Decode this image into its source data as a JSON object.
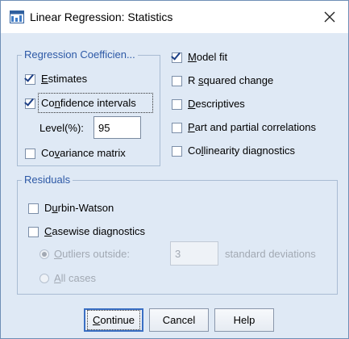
{
  "window": {
    "title": "Linear Regression: Statistics"
  },
  "regression_coefficients": {
    "legend": "Regression Coefficien...",
    "estimates": {
      "label_pre": "",
      "label_u": "E",
      "label_post": "stimates",
      "checked": true
    },
    "confidence_intervals": {
      "label_pre": "Co",
      "label_u": "n",
      "label_post": "fidence intervals",
      "checked": true
    },
    "level_label": "Level(%):",
    "level_value": "95",
    "covariance_matrix": {
      "label_pre": "Co",
      "label_u": "v",
      "label_post": "ariance matrix",
      "checked": false
    }
  },
  "right_options": [
    {
      "label_pre": "",
      "label_u": "M",
      "label_post": "odel fit",
      "checked": true
    },
    {
      "label_pre": "R ",
      "label_u": "s",
      "label_post": "quared change",
      "checked": false
    },
    {
      "label_pre": "",
      "label_u": "D",
      "label_post": "escriptives",
      "checked": false
    },
    {
      "label_pre": "",
      "label_u": "P",
      "label_post": "art and partial correlations",
      "checked": false
    },
    {
      "label_pre": "Co",
      "label_u": "l",
      "label_post": "linearity diagnostics",
      "checked": false
    }
  ],
  "residuals": {
    "legend": "Residuals",
    "durbin_watson": {
      "label_pre": "D",
      "label_u": "u",
      "label_post": "rbin-Watson",
      "checked": false
    },
    "casewise": {
      "label_pre": "",
      "label_u": "C",
      "label_post": "asewise diagnostics",
      "checked": false
    },
    "outliers": {
      "label_pre": "",
      "label_u": "O",
      "label_post": "utliers outside:",
      "selected": true
    },
    "outliers_value": "3",
    "std_dev_label": "standard deviations",
    "all_cases": {
      "label_pre": "",
      "label_u": "A",
      "label_post": "ll cases",
      "selected": false
    }
  },
  "buttons": {
    "continue_pre": "",
    "continue_u": "C",
    "continue_post": "ontinue",
    "cancel": "Cancel",
    "help": "Help"
  }
}
